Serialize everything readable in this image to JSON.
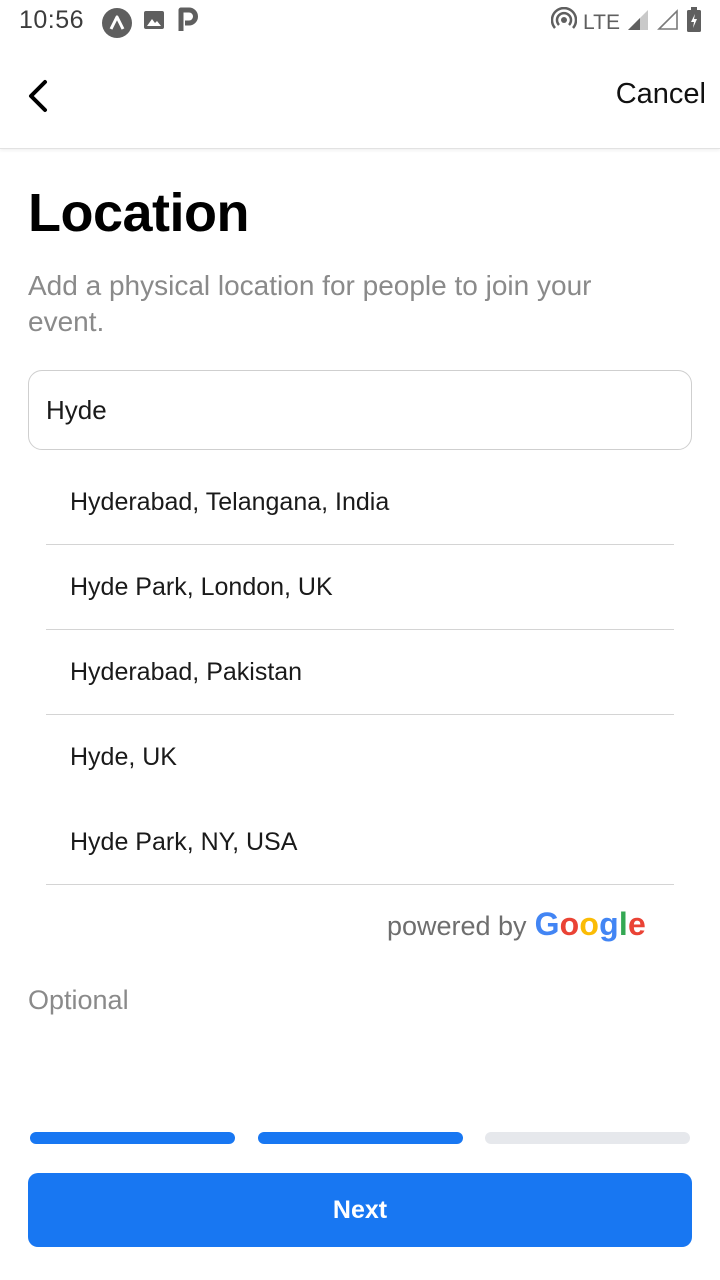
{
  "status_bar": {
    "time": "10:56",
    "network": "LTE",
    "icons_left": [
      "app-a-icon",
      "image-icon",
      "parking-icon"
    ],
    "icons_right": [
      "hotspot-icon",
      "signal-icon",
      "signal-empty-icon",
      "battery-icon"
    ]
  },
  "header": {
    "back_icon": "chevron-left-icon",
    "cancel_label": "Cancel"
  },
  "main": {
    "title": "Location",
    "subtitle": "Add a physical location for people to join your event.",
    "search": {
      "value": "Hyde"
    },
    "suggestions": [
      {
        "label": "Hyderabad, Telangana, India"
      },
      {
        "label": "Hyde Park, London, UK"
      },
      {
        "label": "Hyderabad, Pakistan"
      },
      {
        "label": "Hyde, UK"
      },
      {
        "label": "Hyde Park, NY, USA"
      }
    ],
    "powered_by": {
      "prefix": "powered by",
      "google_letters": [
        "G",
        "o",
        "o",
        "g",
        "l",
        "e"
      ]
    },
    "optional_label": "Optional"
  },
  "progress": {
    "steps_total": 3,
    "steps_completed": 2
  },
  "footer": {
    "next_label": "Next"
  },
  "colors": {
    "accent": "#1877F2",
    "progress_inactive": "#e6e8ec",
    "subtitle": "#8a8a8a",
    "google_blue": "#4285F4",
    "google_red": "#EA4335",
    "google_yellow": "#FBBC05",
    "google_green": "#34A853"
  }
}
